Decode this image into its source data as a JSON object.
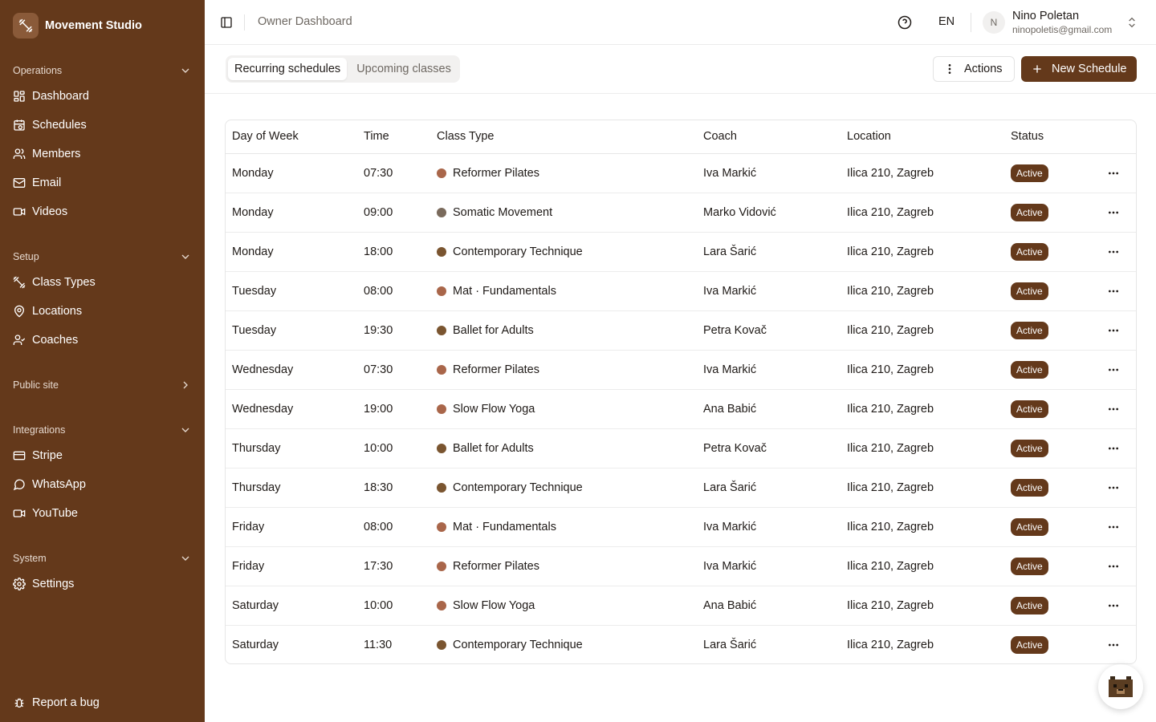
{
  "brand": {
    "name": "Movement Studio",
    "icon": "dumbbell-icon"
  },
  "sidebar": {
    "groups": [
      {
        "label": "Operations",
        "chevron": "chevron-down-icon",
        "items": [
          {
            "label": "Dashboard",
            "icon": "layout-dashboard-icon"
          },
          {
            "label": "Schedules",
            "icon": "calendar-clock-icon"
          },
          {
            "label": "Members",
            "icon": "users-icon"
          },
          {
            "label": "Email",
            "icon": "mail-icon"
          },
          {
            "label": "Videos",
            "icon": "video-icon"
          }
        ]
      },
      {
        "label": "Setup",
        "chevron": "chevron-down-icon",
        "items": [
          {
            "label": "Class Types",
            "icon": "dumbbell-icon"
          },
          {
            "label": "Locations",
            "icon": "map-pin-icon"
          },
          {
            "label": "Coaches",
            "icon": "user-check-icon"
          }
        ]
      },
      {
        "label": "Public site",
        "chevron": "chevron-right-icon",
        "items": []
      },
      {
        "label": "Integrations",
        "chevron": "chevron-down-icon",
        "items": [
          {
            "label": "Stripe",
            "icon": "credit-card-icon"
          },
          {
            "label": "WhatsApp",
            "icon": "message-circle-icon"
          },
          {
            "label": "YouTube",
            "icon": "video-icon"
          }
        ]
      },
      {
        "label": "System",
        "chevron": "chevron-down-icon",
        "items": [
          {
            "label": "Settings",
            "icon": "gear-icon"
          }
        ]
      }
    ],
    "footer": {
      "label": "Report a bug",
      "icon": "bug-icon"
    }
  },
  "header": {
    "breadcrumb": "Owner Dashboard",
    "language": "EN",
    "user": {
      "initial": "N",
      "name": "Nino Poletan",
      "email": "ninopoletis@gmail.com"
    }
  },
  "tabs": [
    {
      "label": "Recurring schedules",
      "active": true
    },
    {
      "label": "Upcoming classes",
      "active": false
    }
  ],
  "toolbar": {
    "actions_label": "Actions",
    "new_label": "New Schedule"
  },
  "colors": {
    "accent": "#64391b",
    "dot_terracotta": "#a9664a",
    "dot_taupe": "#7a6a5c",
    "dot_brown": "#7a5530"
  },
  "table": {
    "columns": [
      "Day of Week",
      "Time",
      "Class Type",
      "Coach",
      "Location",
      "Status"
    ],
    "rows": [
      {
        "day": "Monday",
        "time": "07:30",
        "class_type": "Reformer Pilates",
        "dot": "#a9664a",
        "coach": "Iva Markić",
        "location": "Ilica 210, Zagreb",
        "status": "Active"
      },
      {
        "day": "Monday",
        "time": "09:00",
        "class_type": "Somatic Movement",
        "dot": "#7a6a5c",
        "coach": "Marko Vidović",
        "location": "Ilica 210, Zagreb",
        "status": "Active"
      },
      {
        "day": "Monday",
        "time": "18:00",
        "class_type": "Contemporary Technique",
        "dot": "#7a5530",
        "coach": "Lara Šarić",
        "location": "Ilica 210, Zagreb",
        "status": "Active"
      },
      {
        "day": "Tuesday",
        "time": "08:00",
        "class_type": "Mat · Fundamentals",
        "dot": "#a9664a",
        "coach": "Iva Markić",
        "location": "Ilica 210, Zagreb",
        "status": "Active"
      },
      {
        "day": "Tuesday",
        "time": "19:30",
        "class_type": "Ballet for Adults",
        "dot": "#7a5530",
        "coach": "Petra Kovač",
        "location": "Ilica 210, Zagreb",
        "status": "Active"
      },
      {
        "day": "Wednesday",
        "time": "07:30",
        "class_type": "Reformer Pilates",
        "dot": "#a9664a",
        "coach": "Iva Markić",
        "location": "Ilica 210, Zagreb",
        "status": "Active"
      },
      {
        "day": "Wednesday",
        "time": "19:00",
        "class_type": "Slow Flow Yoga",
        "dot": "#a9664a",
        "coach": "Ana Babić",
        "location": "Ilica 210, Zagreb",
        "status": "Active"
      },
      {
        "day": "Thursday",
        "time": "10:00",
        "class_type": "Ballet for Adults",
        "dot": "#7a5530",
        "coach": "Petra Kovač",
        "location": "Ilica 210, Zagreb",
        "status": "Active"
      },
      {
        "day": "Thursday",
        "time": "18:30",
        "class_type": "Contemporary Technique",
        "dot": "#7a5530",
        "coach": "Lara Šarić",
        "location": "Ilica 210, Zagreb",
        "status": "Active"
      },
      {
        "day": "Friday",
        "time": "08:00",
        "class_type": "Mat · Fundamentals",
        "dot": "#a9664a",
        "coach": "Iva Markić",
        "location": "Ilica 210, Zagreb",
        "status": "Active"
      },
      {
        "day": "Friday",
        "time": "17:30",
        "class_type": "Reformer Pilates",
        "dot": "#a9664a",
        "coach": "Iva Markić",
        "location": "Ilica 210, Zagreb",
        "status": "Active"
      },
      {
        "day": "Saturday",
        "time": "10:00",
        "class_type": "Slow Flow Yoga",
        "dot": "#a9664a",
        "coach": "Ana Babić",
        "location": "Ilica 210, Zagreb",
        "status": "Active"
      },
      {
        "day": "Saturday",
        "time": "11:30",
        "class_type": "Contemporary Technique",
        "dot": "#7a5530",
        "coach": "Lara Šarić",
        "location": "Ilica 210, Zagreb",
        "status": "Active"
      }
    ]
  },
  "help_widget": {
    "icon": "pixel-bear-icon"
  }
}
